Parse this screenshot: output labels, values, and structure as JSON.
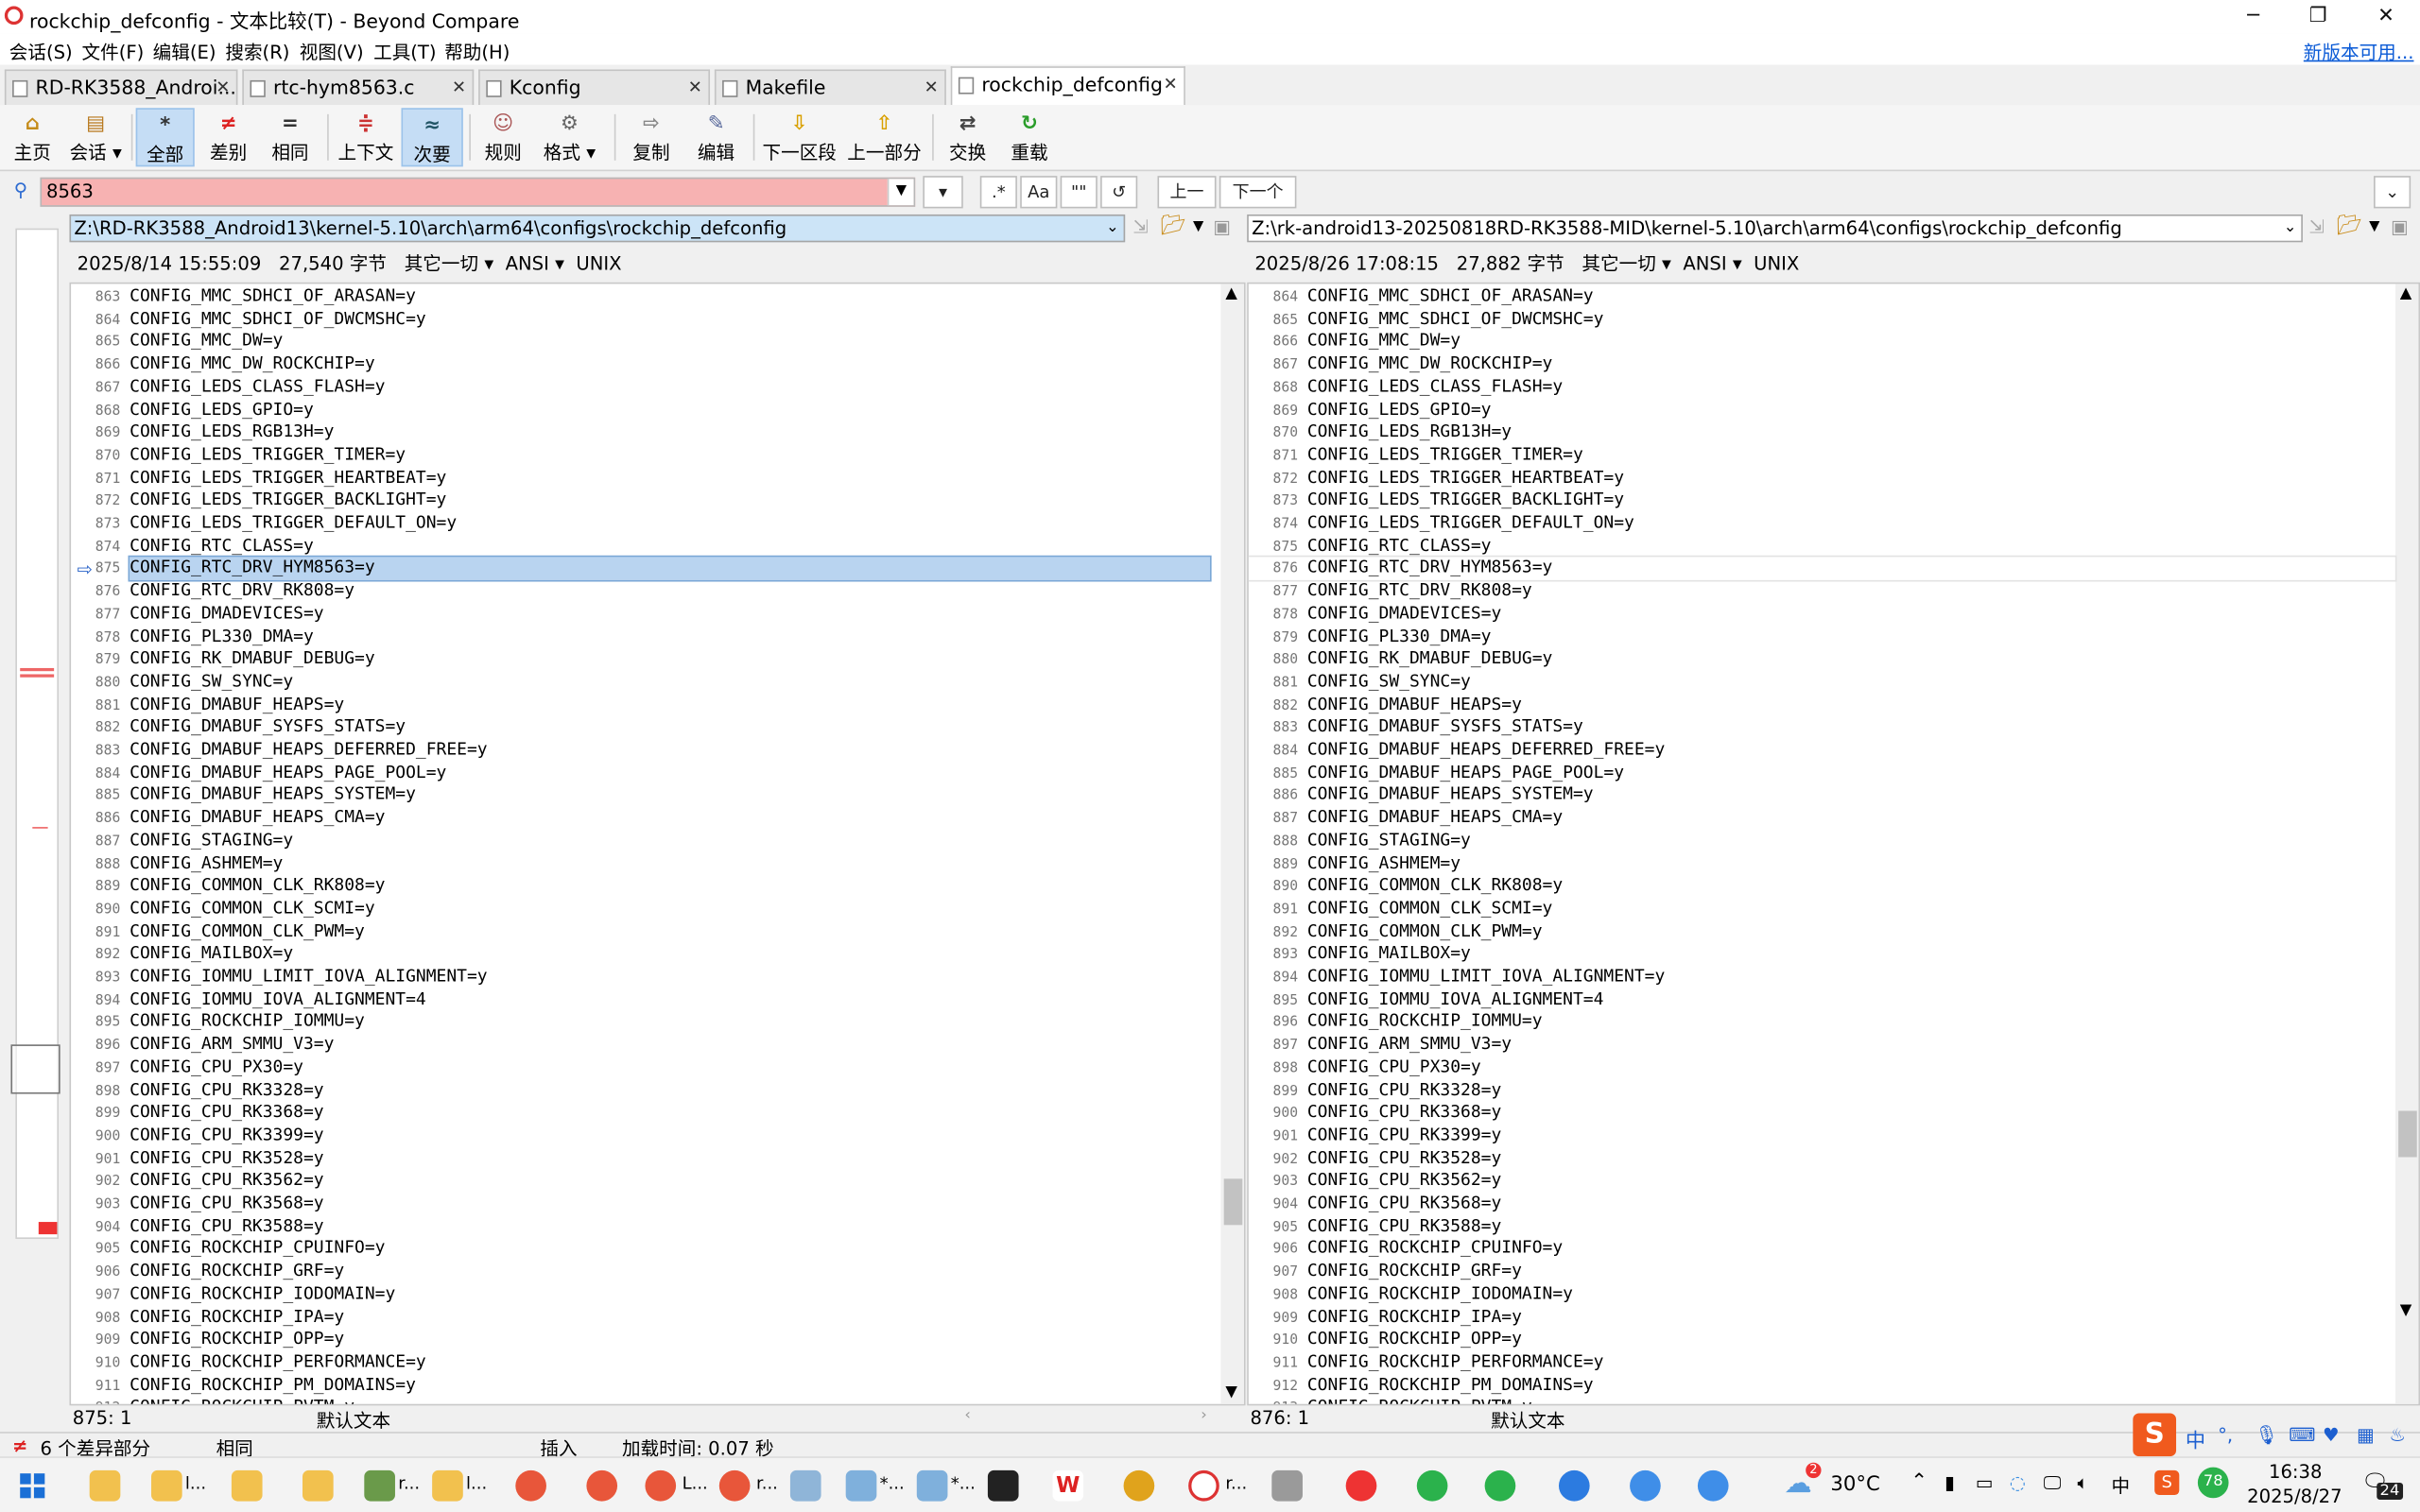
{
  "window": {
    "title": "rockchip_defconfig - 文本比较(T) - Beyond Compare",
    "minimize": "─",
    "restore": "❐",
    "close": "✕"
  },
  "menu": {
    "items": [
      "会话(S)",
      "文件(F)",
      "编辑(E)",
      "搜索(R)",
      "视图(V)",
      "工具(T)",
      "帮助(H)"
    ],
    "new_version": "新版本可用..."
  },
  "tabs": [
    "RD-RK3588_Androi...",
    "rtc-hym8563.c",
    "Kconfig",
    "Makefile",
    "rockchip_defconfig"
  ],
  "toolbar": {
    "home": "主页",
    "session": "会话",
    "all": "全部",
    "diffs": "差别",
    "same": "相同",
    "context": "上下文",
    "minor": "次要",
    "rules": "规则",
    "format": "格式",
    "copy": "复制",
    "edit": "编辑",
    "next_section": "下一区段",
    "prev_section": "上一部分",
    "swap": "交换",
    "reload": "重载"
  },
  "search": {
    "value": "8563",
    "regex": ".*",
    "case": "Aa",
    "word": "\"\"",
    "refresh": "↺",
    "prev": "上一",
    "next": "下一个"
  },
  "left": {
    "path": "Z:\\RD-RK3588_Android13\\kernel-5.10\\arch\\arm64\\configs\\rockchip_defconfig",
    "date": "2025/8/14 15:55:09",
    "size": "27,540 字节",
    "other": "其它一切",
    "encoding": "ANSI",
    "eol": "UNIX",
    "pos": "875: 1",
    "format": "默认文本"
  },
  "right": {
    "path": "Z:\\rk-android13-20250818RD-RK3588-MID\\kernel-5.10\\arch\\arm64\\configs\\rockchip_defconfig",
    "date": "2025/8/26 17:08:15",
    "size": "27,882 字节",
    "other": "其它一切",
    "encoding": "ANSI",
    "eol": "UNIX",
    "pos": "876: 1",
    "format": "默认文本"
  },
  "config_lines": [
    "CONFIG_MMC_SDHCI_OF_ARASAN=y",
    "CONFIG_MMC_SDHCI_OF_DWCMSHC=y",
    "CONFIG_MMC_DW=y",
    "CONFIG_MMC_DW_ROCKCHIP=y",
    "CONFIG_LEDS_CLASS_FLASH=y",
    "CONFIG_LEDS_GPIO=y",
    "CONFIG_LEDS_RGB13H=y",
    "CONFIG_LEDS_TRIGGER_TIMER=y",
    "CONFIG_LEDS_TRIGGER_HEARTBEAT=y",
    "CONFIG_LEDS_TRIGGER_BACKLIGHT=y",
    "CONFIG_LEDS_TRIGGER_DEFAULT_ON=y",
    "CONFIG_RTC_CLASS=y",
    "CONFIG_RTC_DRV_HYM8563=y",
    "CONFIG_RTC_DRV_RK808=y",
    "CONFIG_DMADEVICES=y",
    "CONFIG_PL330_DMA=y",
    "CONFIG_RK_DMABUF_DEBUG=y",
    "CONFIG_SW_SYNC=y",
    "CONFIG_DMABUF_HEAPS=y",
    "CONFIG_DMABUF_SYSFS_STATS=y",
    "CONFIG_DMABUF_HEAPS_DEFERRED_FREE=y",
    "CONFIG_DMABUF_HEAPS_PAGE_POOL=y",
    "CONFIG_DMABUF_HEAPS_SYSTEM=y",
    "CONFIG_DMABUF_HEAPS_CMA=y",
    "CONFIG_STAGING=y",
    "CONFIG_ASHMEM=y",
    "CONFIG_COMMON_CLK_RK808=y",
    "CONFIG_COMMON_CLK_SCMI=y",
    "CONFIG_COMMON_CLK_PWM=y",
    "CONFIG_MAILBOX=y",
    "CONFIG_IOMMU_LIMIT_IOVA_ALIGNMENT=y",
    "CONFIG_IOMMU_IOVA_ALIGNMENT=4",
    "CONFIG_ROCKCHIP_IOMMU=y",
    "CONFIG_ARM_SMMU_V3=y",
    "CONFIG_CPU_PX30=y",
    "CONFIG_CPU_RK3328=y",
    "CONFIG_CPU_RK3368=y",
    "CONFIG_CPU_RK3399=y",
    "CONFIG_CPU_RK3528=y",
    "CONFIG_CPU_RK3562=y",
    "CONFIG_CPU_RK3568=y",
    "CONFIG_CPU_RK3588=y",
    "CONFIG_ROCKCHIP_CPUINFO=y",
    "CONFIG_ROCKCHIP_GRF=y",
    "CONFIG_ROCKCHIP_IODOMAIN=y",
    "CONFIG_ROCKCHIP_IPA=y",
    "CONFIG_ROCKCHIP_OPP=y",
    "CONFIG_ROCKCHIP_PERFORMANCE=y",
    "CONFIG_ROCKCHIP_PM_DOMAINS=y",
    "CONFIG_ROCKCHIP_PVTM=y"
  ],
  "left_start_line": 863,
  "right_start_line": 864,
  "current_index": 12,
  "status": {
    "diff_count": "6 个差异部分",
    "same": "相同",
    "insert": "插入",
    "load_time": "加载时间: 0.07 秒"
  },
  "taskbar": {
    "weather": "30°C",
    "time": "16:38",
    "date": "2025/8/27",
    "notif": "24",
    "ime": "中",
    "labels": [
      "l...",
      "r...",
      "l...",
      "L...",
      "r...",
      "*...",
      "*...",
      "r..."
    ]
  },
  "colors": {
    "search_bg": "#f7b2b2",
    "selected_tool": "#c5ddf5",
    "current_line": "#b9d4f0"
  }
}
